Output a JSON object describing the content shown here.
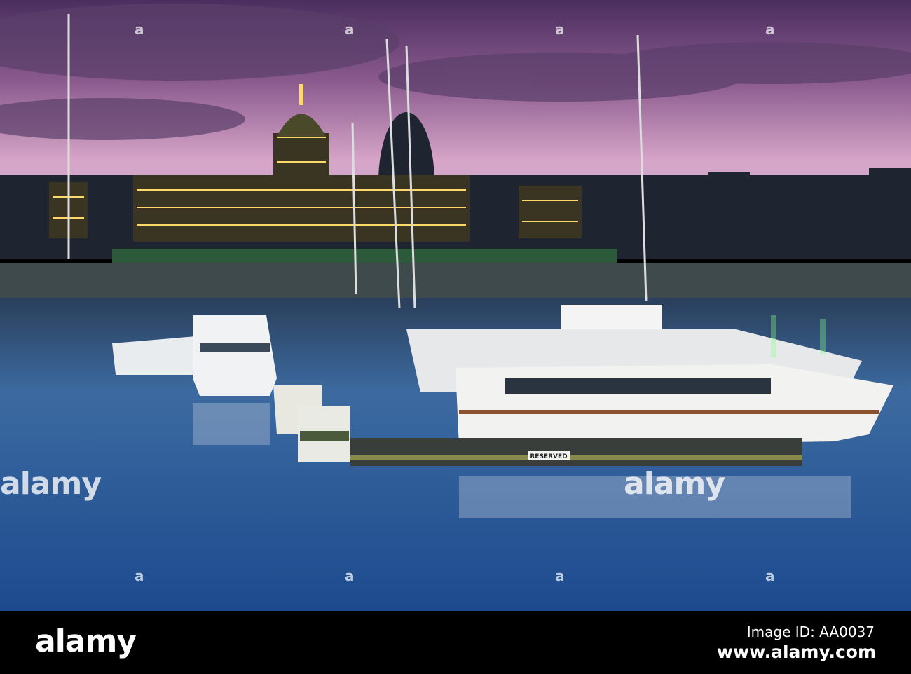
{
  "photo": {
    "subject": "Harbour marina at dusk with illuminated parliament building",
    "dock_sign": "RESERVED",
    "colors": {
      "sky_top": "#5a3a6e",
      "sky_glow": "#e6b6d0",
      "water": "#3a6aa8",
      "lights": "#ffd86a"
    }
  },
  "watermark": {
    "text": "alamy",
    "mark": "a"
  },
  "footer": {
    "logo": "alamy",
    "image_id": "Image ID: AA0037",
    "site": "www.alamy.com"
  }
}
